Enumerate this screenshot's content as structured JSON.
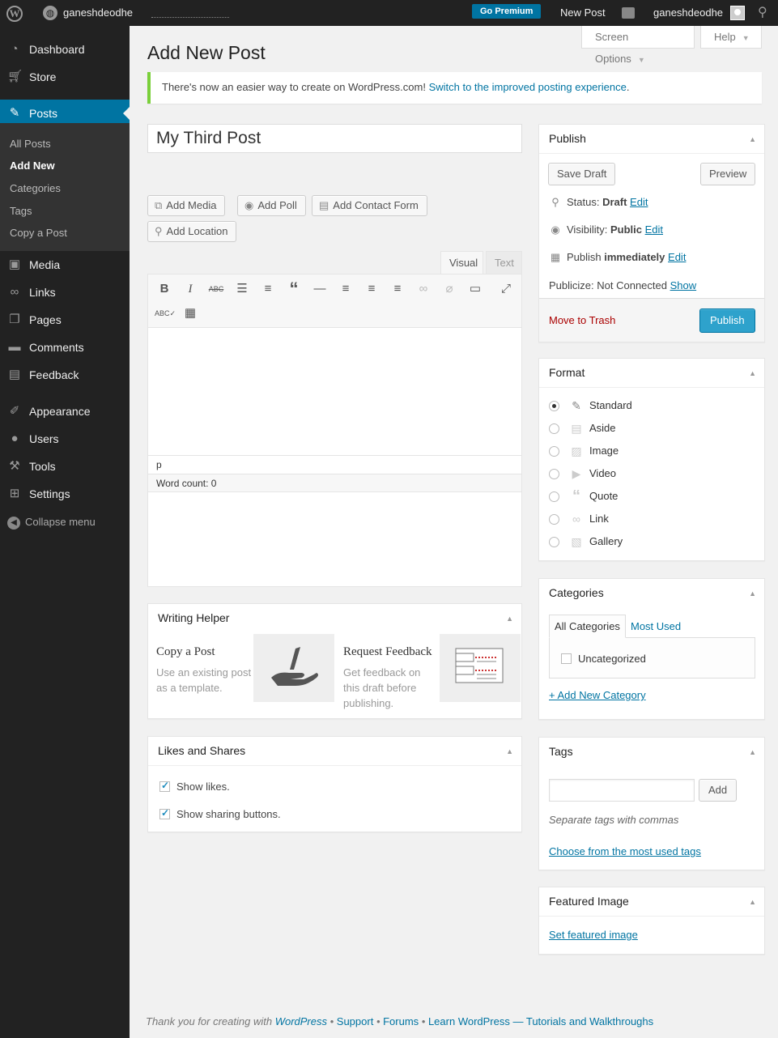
{
  "adminbar": {
    "site_name": "ganeshdeodhe",
    "go_premium": "Go Premium",
    "new_post": "New Post",
    "username": "ganeshdeodhe"
  },
  "sidebar": {
    "items": [
      {
        "label": "Dashboard",
        "icon": "dashboard-icon"
      },
      {
        "label": "Store",
        "icon": "cart-icon"
      },
      {
        "label": "Posts",
        "icon": "pin-icon"
      },
      {
        "label": "Media",
        "icon": "media-icon"
      },
      {
        "label": "Links",
        "icon": "link-icon"
      },
      {
        "label": "Pages",
        "icon": "pages-icon"
      },
      {
        "label": "Comments",
        "icon": "comment-icon"
      },
      {
        "label": "Feedback",
        "icon": "feedback-icon"
      },
      {
        "label": "Appearance",
        "icon": "brush-icon"
      },
      {
        "label": "Users",
        "icon": "user-icon"
      },
      {
        "label": "Tools",
        "icon": "wrench-icon"
      },
      {
        "label": "Settings",
        "icon": "settings-icon"
      }
    ],
    "submenu": [
      "All Posts",
      "Add New",
      "Categories",
      "Tags",
      "Copy a Post"
    ],
    "collapse": "Collapse menu"
  },
  "screen_options": "Screen Options",
  "help": "Help",
  "page_title": "Add New Post",
  "notice": {
    "text": "There's now an easier way to create on WordPress.com! ",
    "link": "Switch to the improved posting experience",
    "suffix": "."
  },
  "post_title": "My Third Post",
  "media_buttons": {
    "add_media": "Add Media",
    "add_poll": "Add Poll",
    "add_contact_form": "Add Contact Form",
    "add_location": "Add Location"
  },
  "editor": {
    "tab_visual": "Visual",
    "tab_text": "Text",
    "path": "p",
    "word_count": "Word count: 0"
  },
  "publish": {
    "title": "Publish",
    "save_draft": "Save Draft",
    "preview": "Preview",
    "status_label": "Status: ",
    "status_value": "Draft",
    "visibility_label": "Visibility: ",
    "visibility_value": "Public",
    "publish_label": "Publish ",
    "publish_value": "immediately",
    "edit": "Edit",
    "publicize_label": "Publicize: Not Connected ",
    "show": "Show",
    "trash": "Move to Trash",
    "publish_button": "Publish"
  },
  "format": {
    "title": "Format",
    "options": [
      "Standard",
      "Aside",
      "Image",
      "Video",
      "Quote",
      "Link",
      "Gallery"
    ],
    "selected": "Standard"
  },
  "categories": {
    "title": "Categories",
    "tab_all": "All Categories",
    "tab_most_used": "Most Used",
    "items": [
      {
        "label": "Uncategorized",
        "checked": false
      }
    ],
    "add_new": "+ Add New Category"
  },
  "tags": {
    "title": "Tags",
    "add": "Add",
    "hint": "Separate tags with commas",
    "choose": "Choose from the most used tags"
  },
  "featured_image": {
    "title": "Featured Image",
    "link": "Set featured image"
  },
  "writing_helper": {
    "title": "Writing Helper",
    "copy_title": "Copy a Post",
    "copy_desc": "Use an existing post as a template.",
    "feedback_title": "Request Feedback",
    "feedback_desc": "Get feedback on this draft before publishing."
  },
  "likes_shares": {
    "title": "Likes and Shares",
    "show_likes": "Show likes.",
    "show_sharing": "Show sharing buttons.",
    "likes_checked": true,
    "sharing_checked": true
  },
  "footer": {
    "thanks": "Thank you for creating with ",
    "wordpress": "WordPress",
    "links": [
      "Support",
      "Forums",
      "Learn WordPress — Tutorials and Walkthroughs"
    ],
    "sep": " • "
  },
  "colors": {
    "accent": "#0074a2",
    "admin_bar": "#222222",
    "notice_border": "#7ad03a",
    "trash": "#a00000",
    "primary_button": "#2ea2cc"
  }
}
